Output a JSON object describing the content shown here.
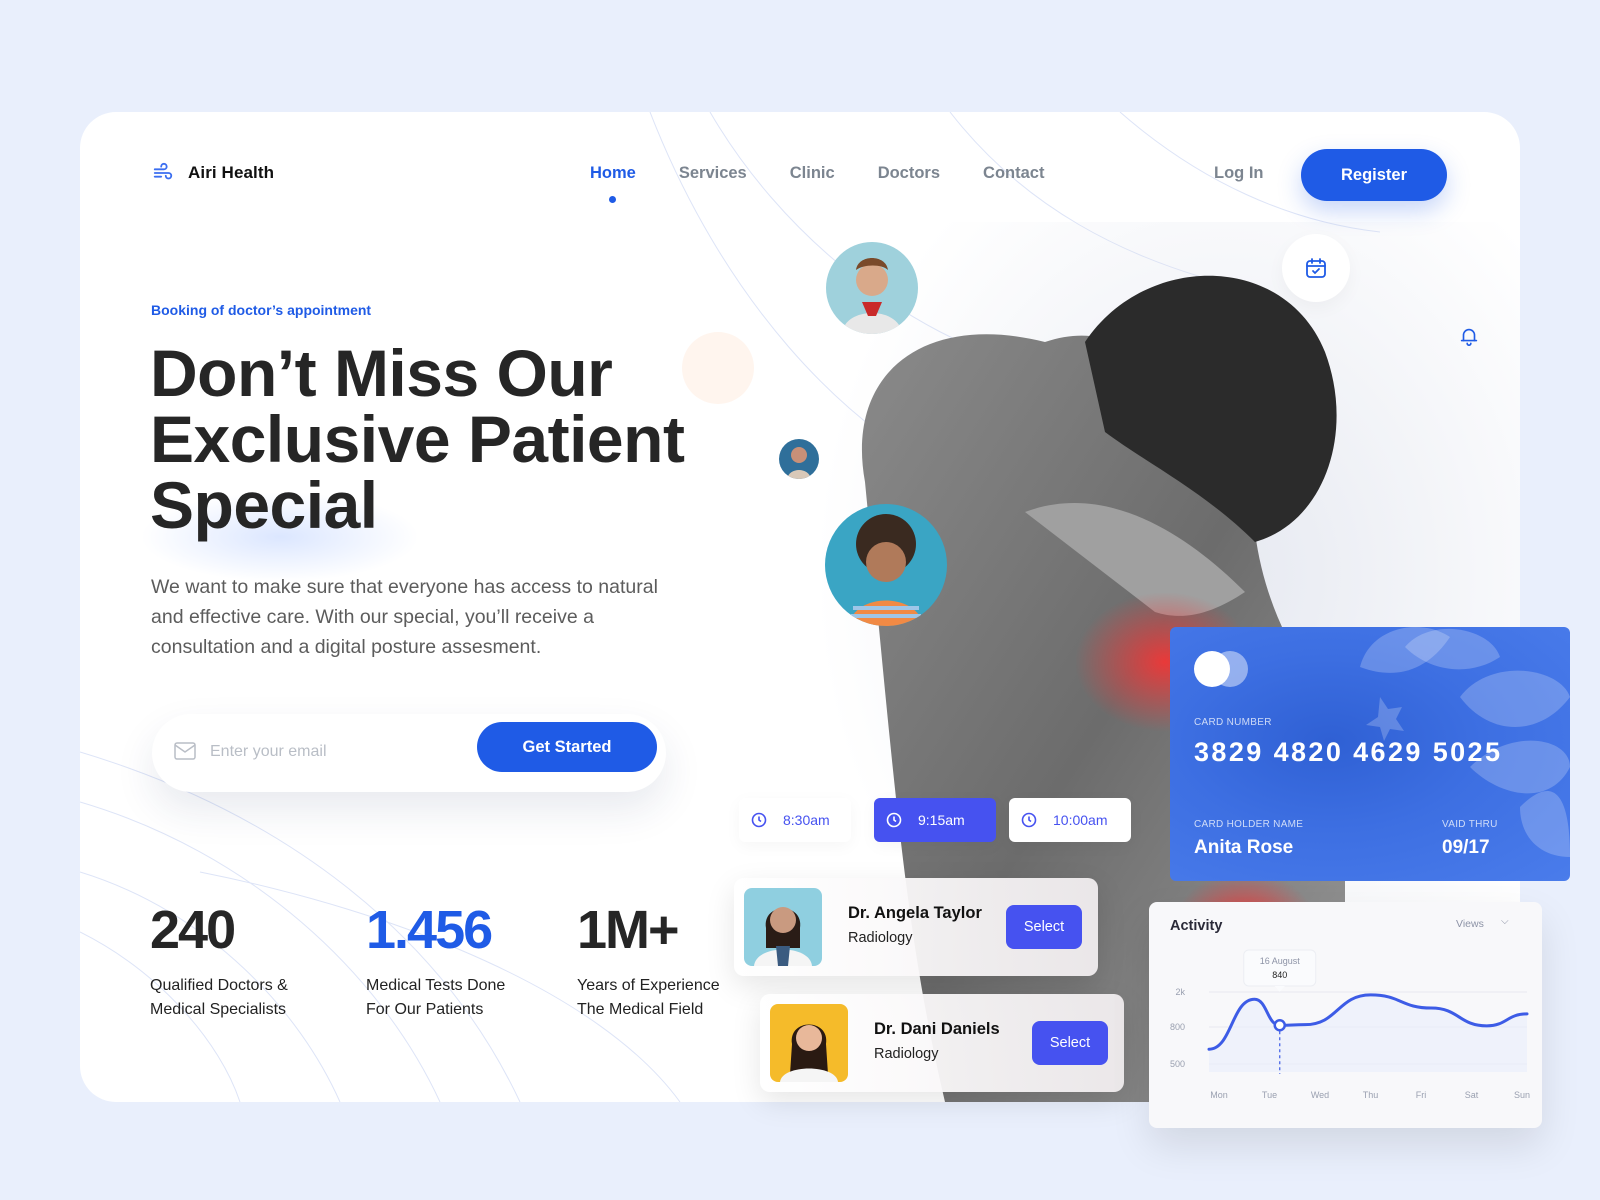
{
  "brand": {
    "name": "Airi Health",
    "logo_icon": "wind-icon"
  },
  "nav": {
    "items": [
      {
        "label": "Home",
        "active": true
      },
      {
        "label": "Services",
        "active": false
      },
      {
        "label": "Clinic",
        "active": false
      },
      {
        "label": "Doctors",
        "active": false
      },
      {
        "label": "Contact",
        "active": false
      }
    ],
    "login_label": "Log In",
    "register_label": "Register"
  },
  "hero": {
    "eyebrow": "Booking of doctor’s appointment",
    "headline": "Don’t Miss Our Exclusive Patient Special",
    "description": "We want to make sure that everyone has access to natural and effective care. With our special, you’ll receive a consultation and a digital posture assesment.",
    "email_placeholder": "Enter your email",
    "email_value": "",
    "cta_label": "Get Started"
  },
  "stats": [
    {
      "value": "240",
      "label_line1": "Qualified Doctors &",
      "label_line2": "Medical Specialists",
      "highlight": false
    },
    {
      "value": "1.456",
      "label_line1": "Medical Tests Done",
      "label_line2": "For Our Patients",
      "highlight": true
    },
    {
      "value": "1M+",
      "label_line1": "Years of Experience",
      "label_line2": "The Medical Field",
      "highlight": false
    }
  ],
  "time_slots": [
    {
      "label": "8:30am",
      "selected": false
    },
    {
      "label": "9:15am",
      "selected": true
    },
    {
      "label": "10:00am",
      "selected": false
    }
  ],
  "doctors": [
    {
      "name": "Dr. Angela Taylor",
      "specialty": "Radiology",
      "select_label": "Select"
    },
    {
      "name": "Dr. Dani Daniels",
      "specialty": "Radiology",
      "select_label": "Select"
    }
  ],
  "credit_card": {
    "number_label": "CARD NUMBER",
    "number": "3829 4820 4629 5025",
    "holder_label": "CARD HOLDER NAME",
    "holder": "Anita Rose",
    "valid_label": "VAID THRU",
    "valid": "09/17"
  },
  "icons": {
    "calendar": "calendar-check-icon",
    "bell": "bell-icon",
    "mail": "mail-icon",
    "clock": "clock-icon"
  },
  "colors": {
    "primary": "#1f5be6",
    "accent": "#4652f0",
    "card": "#3d6fe2",
    "background": "#e9effc"
  },
  "activity": {
    "title": "Activity",
    "filter_label": "Views",
    "chart_data": {
      "type": "line",
      "title": "Activity",
      "categories": [
        "Mon",
        "Tue",
        "Wed",
        "Thu",
        "Fri",
        "Sat",
        "Sun"
      ],
      "y_tick_labels": [
        "2k",
        "800",
        "500"
      ],
      "series": [
        {
          "name": "Views",
          "values": [
            620,
            1750,
            860,
            880,
            1900,
            1450,
            840,
            1250
          ]
        }
      ],
      "x_positions": [
        0,
        1,
        1.5,
        2,
        3.3,
        4.5,
        5.6,
        6.0
      ],
      "tooltip": {
        "date": "16 August",
        "value": "840",
        "x_index": 1.5
      },
      "grid": true
    }
  }
}
